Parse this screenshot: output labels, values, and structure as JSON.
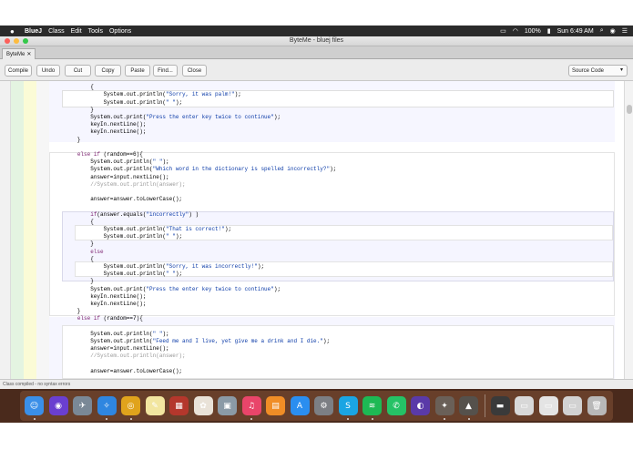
{
  "menubar": {
    "app_name": "BlueJ",
    "menus": [
      "Class",
      "Edit",
      "Tools",
      "Options"
    ],
    "battery": "100%",
    "clock": "Sun 6:49 AM"
  },
  "window": {
    "title": "ByteMe - bluej files",
    "tab_label": "ByteMe",
    "tab_close": "✕"
  },
  "toolbar": {
    "compile": "Compile",
    "undo": "Undo",
    "cut": "Cut",
    "copy": "Copy",
    "paste": "Paste",
    "find": "Find...",
    "close": "Close",
    "view_select": "Source Code"
  },
  "code": {
    "lines": [
      "            else",
      "            {",
      "                System.out.println(\"Sorry, it was palm!\");",
      "                System.out.println(\" \");",
      "            }",
      "            System.out.print(\"Press the enter key twice to continue\");",
      "            keyIn.nextLine();",
      "            keyIn.nextLine();",
      "        }",
      "",
      "        else if (random==6){",
      "            System.out.println(\" \");",
      "            System.out.println(\"Which word in the dictionary is spelled incorrectly?\");",
      "            answer=input.nextLine();",
      "            //System.out.println(answer);",
      "",
      "            answer=answer.toLowerCase();",
      "",
      "            if(answer.equals(\"incorrectly\") )",
      "            {",
      "                System.out.println(\"That is correct!\");",
      "                System.out.println(\" \");",
      "            }",
      "            else",
      "            {",
      "                System.out.println(\"Sorry, it was incorrectly!\");",
      "                System.out.println(\" \");",
      "            }",
      "            System.out.print(\"Press the enter key twice to continue\");",
      "            keyIn.nextLine();",
      "            keyIn.nextLine();",
      "        }",
      "        else if (random==7){",
      "",
      "            System.out.println(\" \");",
      "            System.out.println(\"Feed me and I live, yet give me a drink and I die.\");",
      "            answer=input.nextLine();",
      "            //System.out.println(answer);",
      "",
      "            answer=answer.toLowerCase();"
    ]
  },
  "status": {
    "message": "Class compiled - no syntax errors"
  },
  "dock": {
    "apps": [
      {
        "name": "finder-icon",
        "glyph": "☺",
        "color": "#3a8fe8"
      },
      {
        "name": "siri-icon",
        "glyph": "◉",
        "color": "#6a3fd0"
      },
      {
        "name": "launchpad-icon",
        "glyph": "✈",
        "color": "#7a8896"
      },
      {
        "name": "safari-icon",
        "glyph": "✧",
        "color": "#2f86e0"
      },
      {
        "name": "chrome-icon",
        "glyph": "◎",
        "color": "#e0a31c"
      },
      {
        "name": "notes-icon",
        "glyph": "✎",
        "color": "#f2e6a0"
      },
      {
        "name": "photo-booth-icon",
        "glyph": "▦",
        "color": "#b4372c"
      },
      {
        "name": "photos-icon",
        "glyph": "✿",
        "color": "#e9e2d8"
      },
      {
        "name": "preview-icon",
        "glyph": "▣",
        "color": "#8b9aa6"
      },
      {
        "name": "itunes-icon",
        "glyph": "♫",
        "color": "#e9456a"
      },
      {
        "name": "books-icon",
        "glyph": "▤",
        "color": "#f08d26"
      },
      {
        "name": "app-store-icon",
        "glyph": "A",
        "color": "#2a8ef0"
      },
      {
        "name": "system-preferences-icon",
        "glyph": "⚙",
        "color": "#7c7f84"
      },
      {
        "name": "skype-icon",
        "glyph": "S",
        "color": "#1aa5e3"
      },
      {
        "name": "spotify-icon",
        "glyph": "≋",
        "color": "#1db954"
      },
      {
        "name": "whatsapp-icon",
        "glyph": "✆",
        "color": "#25c266"
      },
      {
        "name": "github-icon",
        "glyph": "◐",
        "color": "#5a3aa8"
      },
      {
        "name": "gimp-icon",
        "glyph": "✦",
        "color": "#6a6058"
      },
      {
        "name": "bluej-icon",
        "glyph": "▲",
        "color": "#55514c"
      },
      {
        "name": "doc-stack-icon-1",
        "glyph": "▬",
        "color": "#3a3a3a"
      },
      {
        "name": "doc-stack-icon-2",
        "glyph": "▭",
        "color": "#d8d8d8"
      },
      {
        "name": "doc-stack-icon-3",
        "glyph": "▭",
        "color": "#e4e4e4"
      },
      {
        "name": "doc-stack-icon-4",
        "glyph": "▭",
        "color": "#d2d2d2"
      },
      {
        "name": "trash-icon",
        "glyph": "🗑",
        "color": "#b8b8b8"
      }
    ]
  }
}
